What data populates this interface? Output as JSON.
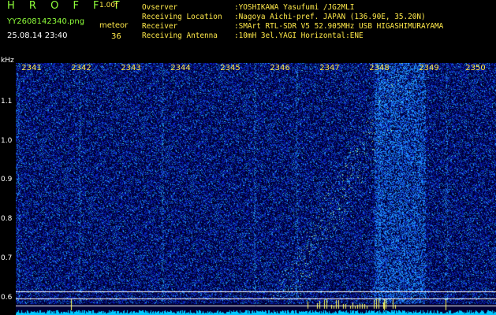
{
  "header": {
    "app_title": "H R O F F T",
    "version": "1.00f",
    "file_name": "YY2608142340.png",
    "mode": "meteor",
    "timestamp": "25.08.14 23:40",
    "count": "36"
  },
  "station_info": [
    {
      "label": "Ovserver",
      "value": ":YOSHIKAWA Yasufumi /JG2MLI"
    },
    {
      "label": "Receiving Location",
      "value": ":Nagoya Aichi-pref. JAPAN (136.90E, 35.20N)"
    },
    {
      "label": "Receiver",
      "value": ":SMArt RTL-SDR V5 52.905MHz USB HIGASHIMURAYAMA"
    },
    {
      "label": "Receiving Antenna",
      "value": ":10mH 3el.YAGI Horizontal:ENE"
    }
  ],
  "chart_data": {
    "type": "heatmap",
    "ylabel": "kHz",
    "y_ticks": [
      "1.1",
      "1.0",
      "0.9",
      "0.8",
      "0.7",
      "0.6"
    ],
    "x_ticks": [
      "2341",
      "2342",
      "2343",
      "2344",
      "2345",
      "2346",
      "2347",
      "2348",
      "2349",
      "2350"
    ],
    "ylim": [
      0.58,
      1.18
    ],
    "colors": {
      "background": "#000033",
      "low": "#1030c8",
      "mid": "#00c8ff",
      "high": "#ffff60",
      "grid": "#ffffff"
    }
  }
}
